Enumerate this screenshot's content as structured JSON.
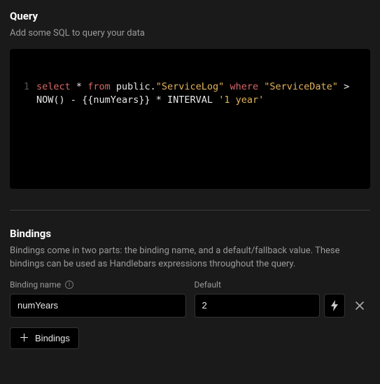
{
  "query": {
    "title": "Query",
    "desc": "Add some SQL to query your data",
    "line_number": "1",
    "tokens": {
      "select": "select",
      "star": "*",
      "from": "from",
      "public": "public",
      "dot": ".",
      "servicelog": "\"ServiceLog\"",
      "where": "where",
      "servicedate": "\"ServiceDate\"",
      "gt": ">",
      "now": "NOW()",
      "minus": "-",
      "binding": "{{numYears}}",
      "star2": "*",
      "interval": "INTERVAL",
      "one_year": "'1 year'"
    }
  },
  "bindings": {
    "title": "Bindings",
    "desc": "Bindings come in two parts: the binding name, and a default/fallback value. These bindings can be used as Handlebars expressions throughout the query.",
    "name_label": "Binding name",
    "default_label": "Default",
    "rows": [
      {
        "name": "numYears",
        "default": "2"
      }
    ],
    "add_label": "Bindings"
  }
}
